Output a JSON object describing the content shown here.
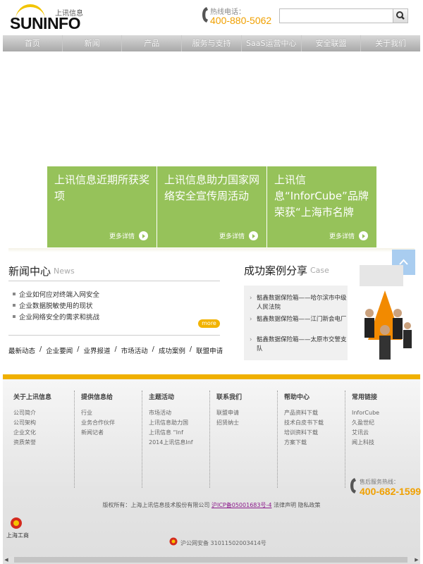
{
  "header": {
    "logo_text": "SUNINFO",
    "logo_cn": "上讯信息",
    "hotline_label": "热线电话：",
    "hotline_number": "400-880-5062"
  },
  "search": {
    "value": "",
    "placeholder": ""
  },
  "nav": [
    "首页",
    "新闻",
    "产品",
    "服务与支持",
    "SaaS运营中心",
    "安全联盟",
    "关于我们"
  ],
  "cards": [
    {
      "title": "上讯信息近期所获奖项",
      "more": "更多详情"
    },
    {
      "title": "上讯信息助力国家网络安全宣传周活动",
      "more": "更多详情"
    },
    {
      "title": "上讯信息“InforCube”品牌荣获“上海市名牌",
      "more": "更多详情"
    }
  ],
  "news": {
    "title": "新闻中心",
    "title_en": "News",
    "items": [
      "企业如何应对终端入网安全",
      "企业数据脱敏使用的现状",
      "企业网络安全的需求和挑战"
    ],
    "more": "more",
    "categories": [
      "最新动态",
      "企业要闻",
      "业界报道",
      "市场活动",
      "成功案例",
      "联盟申请"
    ],
    "separator": "/"
  },
  "cases": {
    "title": "成功案例分享",
    "title_en": "Case",
    "items": [
      "骷鑫数据保险箱——哈尔滨市中级人民法院",
      "骷鑫数据保险箱——江门新会电厂",
      "骷鑫数据保险箱——太原市交警支队"
    ]
  },
  "footer": {
    "columns": [
      {
        "heading": "关于上讯信息",
        "links": [
          "公司简介",
          "公司架构",
          "企业文化",
          "资质荣誉"
        ]
      },
      {
        "heading": "提供信息给",
        "links": [
          "行业",
          "业务合作伙伴",
          "新闻记者"
        ]
      },
      {
        "heading": "主题活动",
        "links": [
          "市场活动",
          "上讯信息助力国",
          "上讯信息 “Inf",
          "2014上讯信息Inf"
        ]
      },
      {
        "heading": "联系我们",
        "links": [
          "联盟申请",
          "招贤纳士"
        ]
      },
      {
        "heading": "帮助中心",
        "links": [
          "产品资料下载",
          "技术白皮书下载",
          "培训资料下载",
          "方案下载"
        ]
      },
      {
        "heading": "常用链接",
        "links": [
          "InforCube",
          "久盈世纪",
          "艾讯云",
          "闻上科技"
        ]
      }
    ],
    "aftersale_label": "售后服务热线：",
    "aftersale_number": "400-682-1599",
    "copyright_prefix": "版权所有：上海上讯信息技术股份有限公司",
    "icp": "沪ICP备05001683号-4",
    "legal": "法律声明",
    "privacy": "隐私政策",
    "biz_label": "上海工商",
    "police": "沪公网安备 31011502003414号"
  },
  "colors": {
    "accent_green": "#96c25a",
    "accent_orange": "#f0a000",
    "footer_bar": "#f0b000"
  }
}
